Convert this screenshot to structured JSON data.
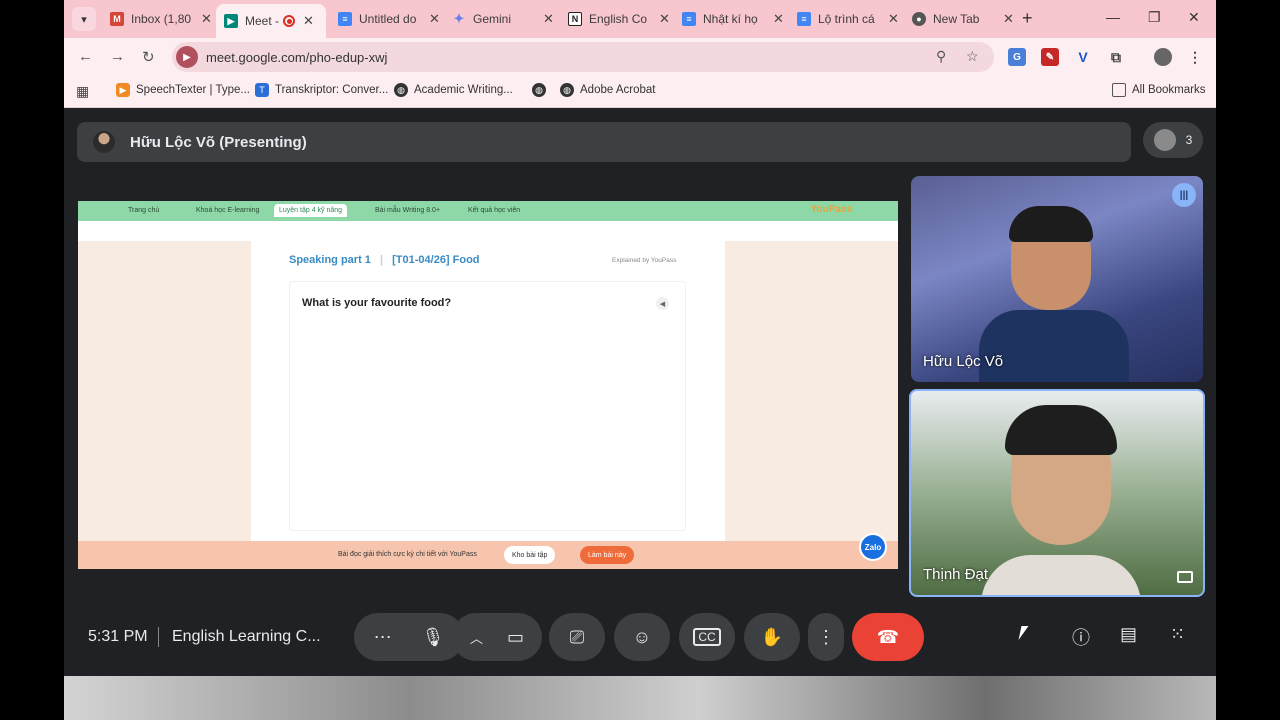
{
  "browser": {
    "tabs": [
      {
        "label": "Inbox (1,80",
        "icon": "gmail-icon",
        "color": "#d44638"
      },
      {
        "label": "Meet -",
        "icon": "meet-icon",
        "color": "#00897b"
      },
      {
        "label": "Untitled do",
        "icon": "docs-icon",
        "color": "#4285f4"
      },
      {
        "label": "Gemini",
        "icon": "gemini-icon",
        "color": "#6b7ee8"
      },
      {
        "label": "English Co",
        "icon": "notion-icon",
        "color": "#222222"
      },
      {
        "label": "Nhật kí họ",
        "icon": "docs-icon",
        "color": "#4285f4"
      },
      {
        "label": "Lộ trình cá",
        "icon": "docs-icon",
        "color": "#4285f4"
      },
      {
        "label": "New Tab",
        "icon": "chrome-icon",
        "color": "#555555"
      }
    ],
    "url": "meet.google.com/pho-edup-xwj",
    "bookmarks": [
      {
        "label": "SpeechTexter | Type..."
      },
      {
        "label": "Transkriptor: Conver..."
      },
      {
        "label": "Academic Writing..."
      },
      {
        "label": ""
      },
      {
        "label": "Adobe Acrobat"
      }
    ],
    "all_bookmarks": "All Bookmarks"
  },
  "meet": {
    "presenter": "Hữu Lộc Võ (Presenting)",
    "participant_count": "3",
    "time": "5:31 PM",
    "meeting_name": "English Learning C...",
    "tiles": [
      {
        "name": "Hữu Lộc Võ"
      },
      {
        "name": "Thịnh Đạt"
      }
    ]
  },
  "shared": {
    "nav": [
      "Trang chủ",
      "Khoá học E-learning",
      "Luyện tập 4 kỹ năng",
      "Bài mẫu Writing 8.0+",
      "Kết quả học viên"
    ],
    "logo": "YouPass",
    "heading_part": "Speaking part 1",
    "heading_topic": "[T01-04/26] Food",
    "explained": "Explained by YouPass",
    "question": "What is your favourite food?",
    "footer_text": "Bài đọc giải thích cực kỳ chi tiết với YouPass",
    "btn_library": "Kho bài tập",
    "btn_do": "Làm bài này",
    "zalo": "Zalo"
  }
}
